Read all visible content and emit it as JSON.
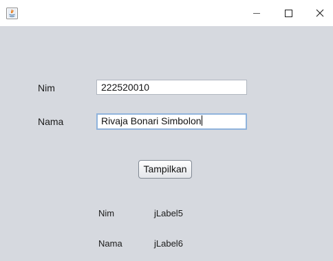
{
  "window": {
    "title": "",
    "app_icon": "java-app-icon",
    "controls": {
      "minimize_icon": "minimize-icon",
      "maximize_icon": "maximize-icon",
      "close_icon": "close-icon"
    }
  },
  "form": {
    "nim_label": "Nim",
    "nim_value": "222520010",
    "nama_label": "Nama",
    "nama_value": "Rivaja Bonari Simbolon",
    "button_label": "Tampilkan"
  },
  "output": {
    "nim_label": "Nim",
    "nim_value": "jLabel5",
    "nama_label": "Nama",
    "nama_value": "jLabel6"
  },
  "colors": {
    "window_background": "#d6d9df",
    "titlebar_background": "#ffffff",
    "focus_border": "#8fb3dc"
  }
}
